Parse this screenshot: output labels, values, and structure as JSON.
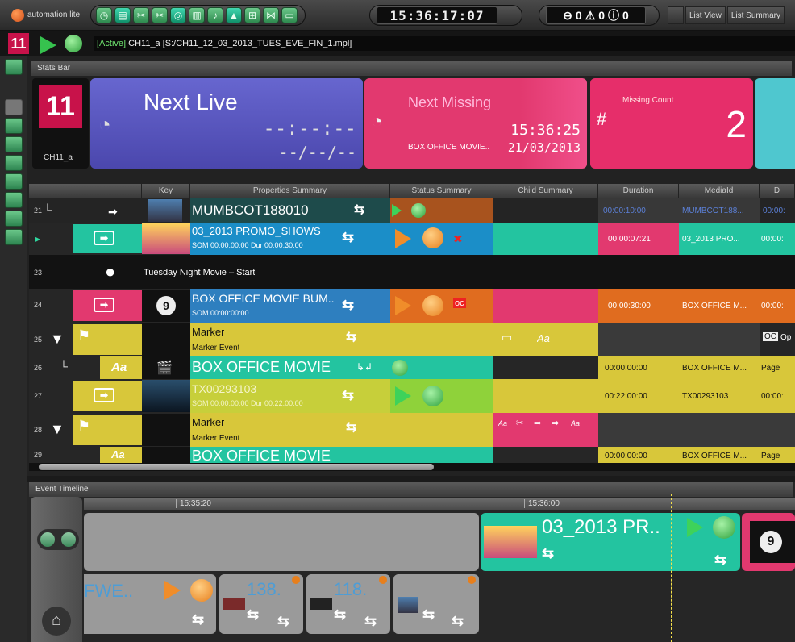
{
  "app": {
    "title": "automation lite"
  },
  "toolbar": {
    "clock": "15:36:17:07",
    "status_ok": "0",
    "status_warn": "0",
    "status_err": "0",
    "view1": "List View",
    "view2": "List Summary"
  },
  "channel": {
    "logo": "11",
    "status": "[Active]",
    "path": " CH11_a [S:/CH11_12_03_2013_TUES_EVE_FIN_1.mpl]"
  },
  "stats": {
    "panel": "Stats Bar",
    "channel_label": "CH11_a",
    "next_live": {
      "title": "Next Live",
      "time": "--:--:--",
      "date": "--/--/--"
    },
    "next_missing": {
      "title": "Next Missing",
      "time": "15:36:25",
      "date": "21/03/2013",
      "item": "BOX OFFICE MOVIE.."
    },
    "missing_count": {
      "title": "Missing Count",
      "value": "2"
    }
  },
  "table": {
    "headers": [
      "Key",
      "Properties Summary",
      "Status Summary",
      "Child Summary",
      "Duration",
      "MediaId",
      "D"
    ],
    "rows": [
      {
        "num": "21",
        "title": "MUMBCOT188010",
        "sub": "",
        "duration": "00:00:10:00",
        "media": "MUMBCOT188...",
        "d": "00:00:"
      },
      {
        "num": "",
        "title": "03_2013 PROMO_SHOWS",
        "sub": "SOM 00:00:00:00 Dur 00:00:30:00",
        "duration": "00:00:07:21",
        "media": "03_2013 PRO...",
        "d": "00:00:"
      },
      {
        "num": "23",
        "title": "Tuesday Night Movie – Start"
      },
      {
        "num": "24",
        "key": "9",
        "title": "BOX OFFICE MOVIE BUM..",
        "sub": "SOM 00:00:00:00",
        "duration": "00:00:30:00",
        "media": "BOX OFFICE M...",
        "d": "00:00:"
      },
      {
        "num": "25",
        "title": "Marker",
        "sub": "Marker Event",
        "child": "Aa",
        "d": "Op"
      },
      {
        "num": "26",
        "key": "Aa",
        "title": "BOX OFFICE MOVIE",
        "duration": "00:00:00:00",
        "media": "BOX OFFICE M...",
        "d": "Page"
      },
      {
        "num": "27",
        "title": "TX00293103",
        "sub": "SOM 00:00:00:00 Dur 00:22:00:00",
        "duration": "00:22:00:00",
        "media": "TX00293103",
        "d": "00:00:"
      },
      {
        "num": "28",
        "title": "Marker",
        "sub": "Marker Event",
        "child": "Aa",
        "child2": "Aa"
      },
      {
        "num": "29",
        "key": "Aa",
        "title": "BOX OFFICE MOVIE",
        "duration": "00:00:00:00",
        "media": "BOX OFFICE M...",
        "d": "Page"
      }
    ]
  },
  "timeline": {
    "panel": "Event Timeline",
    "t1": "15:35:20",
    "t2": "15:36:00",
    "block_main": "03_2013 PR..",
    "block_key": "9",
    "small1": "FWE..",
    "small2": "138.",
    "small3": "118."
  }
}
